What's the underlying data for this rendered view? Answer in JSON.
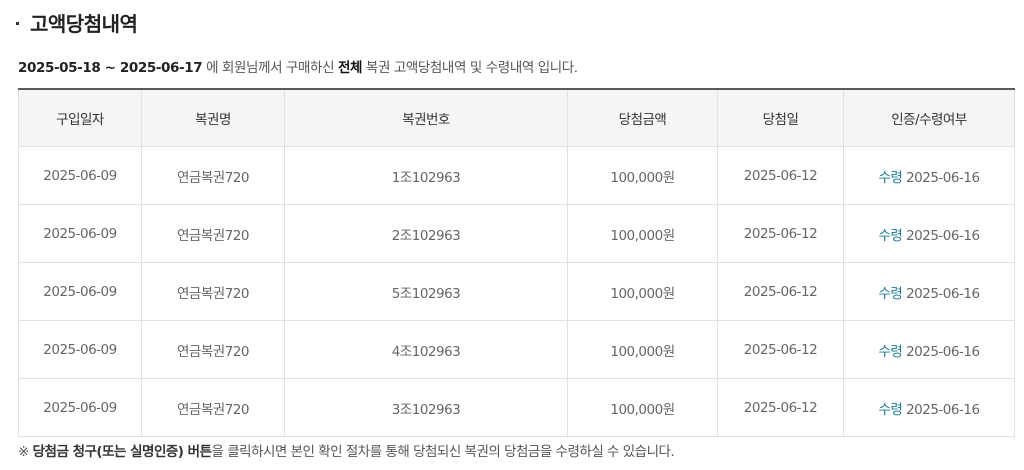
{
  "header": {
    "title": "고액당첨내역"
  },
  "summary": {
    "period": "2025-05-18 ~ 2025-06-17",
    "text_before_scope": " 에 회원님께서 구매하신 ",
    "scope": "전체",
    "text_after_scope": " 복권 고액당첨내역 및 수령내역 입니다."
  },
  "table": {
    "columns": [
      "구입일자",
      "복권명",
      "복권번호",
      "당첨금액",
      "당첨일",
      "인증/수령여부"
    ],
    "rows": [
      {
        "purchase_date": "2025-06-09",
        "lottery_name": "연금복권720",
        "ticket_number": "1조102963",
        "prize_amount": "100,000원",
        "win_date": "2025-06-12",
        "status_label": "수령",
        "status_date": "2025-06-16"
      },
      {
        "purchase_date": "2025-06-09",
        "lottery_name": "연금복권720",
        "ticket_number": "2조102963",
        "prize_amount": "100,000원",
        "win_date": "2025-06-12",
        "status_label": "수령",
        "status_date": "2025-06-16"
      },
      {
        "purchase_date": "2025-06-09",
        "lottery_name": "연금복권720",
        "ticket_number": "5조102963",
        "prize_amount": "100,000원",
        "win_date": "2025-06-12",
        "status_label": "수령",
        "status_date": "2025-06-16"
      },
      {
        "purchase_date": "2025-06-09",
        "lottery_name": "연금복권720",
        "ticket_number": "4조102963",
        "prize_amount": "100,000원",
        "win_date": "2025-06-12",
        "status_label": "수령",
        "status_date": "2025-06-16"
      },
      {
        "purchase_date": "2025-06-09",
        "lottery_name": "연금복권720",
        "ticket_number": "3조102963",
        "prize_amount": "100,000원",
        "win_date": "2025-06-12",
        "status_label": "수령",
        "status_date": "2025-06-16"
      }
    ]
  },
  "note": {
    "prefix": "※ ",
    "strong": "당첨금 청구(또는 실명인증) 버튼",
    "rest": "을 클릭하시면 본인 확인 절차를 통해 당첨되신 복권의 당첨금을 수령하실 수 있습니다."
  },
  "colors": {
    "status_accent": "#1d7a91",
    "header_bg": "#f5f5f5",
    "table_top_border": "#5a5a5a"
  }
}
